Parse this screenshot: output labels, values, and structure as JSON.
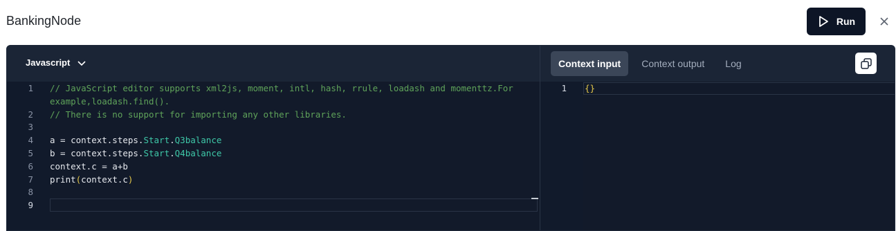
{
  "app": {
    "title": "BankingNode"
  },
  "header": {
    "run_label": "Run"
  },
  "editor": {
    "language": "Javascript",
    "lines": [
      {
        "num": "1",
        "parts": [
          {
            "t": "// JavaScript editor supports xml2js, moment, intl, hash, rrule, loadash and momenttz.For",
            "c": "cm"
          }
        ]
      },
      {
        "num": "",
        "parts": [
          {
            "t": "example,loadash.find().",
            "c": "cm"
          }
        ]
      },
      {
        "num": "2",
        "parts": [
          {
            "t": "// There is no support for importing any other libraries.",
            "c": "cm"
          }
        ]
      },
      {
        "num": "3",
        "parts": []
      },
      {
        "num": "4",
        "parts": [
          {
            "t": "a = context.steps.",
            "c": ""
          },
          {
            "t": "Start",
            "c": "tk"
          },
          {
            "t": ".",
            "c": ""
          },
          {
            "t": "Q3balance",
            "c": "tk"
          }
        ]
      },
      {
        "num": "5",
        "parts": [
          {
            "t": "b = context.steps.",
            "c": ""
          },
          {
            "t": "Start",
            "c": "tk"
          },
          {
            "t": ".",
            "c": ""
          },
          {
            "t": "Q4balance",
            "c": "tk"
          }
        ]
      },
      {
        "num": "6",
        "parts": [
          {
            "t": "context.c = a+b",
            "c": ""
          }
        ]
      },
      {
        "num": "7",
        "parts": [
          {
            "t": "print",
            "c": ""
          },
          {
            "t": "(",
            "c": "pr"
          },
          {
            "t": "context.c",
            "c": ""
          },
          {
            "t": ")",
            "c": "pr"
          }
        ]
      },
      {
        "num": "8",
        "parts": []
      },
      {
        "num": "9",
        "parts": [],
        "current": true
      }
    ]
  },
  "context_panel": {
    "tabs": [
      {
        "label": "Context input",
        "active": true
      },
      {
        "label": "Context output",
        "active": false
      },
      {
        "label": "Log",
        "active": false
      }
    ],
    "lines": [
      {
        "num": "1",
        "text": "{}"
      }
    ]
  },
  "icons": {
    "run": "play-icon",
    "close": "close-icon",
    "language_dropdown": "chevron-down-icon",
    "copy": "copy-icon"
  },
  "colors": {
    "panel_bg": "#111a2b",
    "toolbar_bg": "#1b2536",
    "run_button_bg": "#0d1526",
    "comment": "#5fa35a",
    "token": "#3ec8a8",
    "brace": "#e5c84a"
  }
}
